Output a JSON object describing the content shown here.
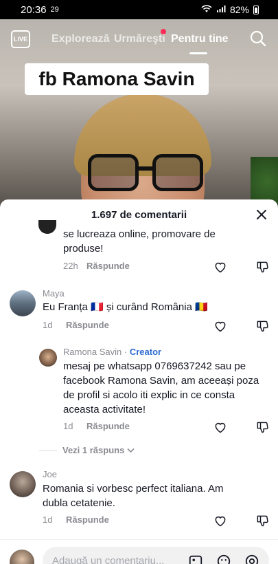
{
  "status_bar": {
    "time": "20:36",
    "notif": "29",
    "battery": "82%"
  },
  "top_nav": {
    "live_label": "LIVE",
    "tabs": [
      {
        "label": "Explorează"
      },
      {
        "label": "Urmăreşti"
      },
      {
        "label": "Pentru tine",
        "active": true
      }
    ]
  },
  "video": {
    "overlay_text": "fb Ramona Savin"
  },
  "comments": {
    "title": "1.697 de comentarii",
    "items": [
      {
        "text": "se lucreaza online, promovare de produse!",
        "time": "22h",
        "reply": "Răspunde"
      },
      {
        "user": "Maya",
        "text": "Eu Franța 🇫🇷 și curând România 🇷🇴",
        "time": "1d",
        "reply": "Răspunde"
      },
      {
        "user": "Ramona Savin",
        "creator_label": "Creator",
        "text": "mesaj pe whatsapp 0769637242 sau pe facebook Ramona Savin, am aceeași poza de profil si acolo iti explic in ce consta aceasta activitate!",
        "time": "1d",
        "reply": "Răspunde"
      },
      {
        "user": "Joe",
        "text": "Romania si vorbesc perfect italiana. Am dubla cetatenie.",
        "time": "1d",
        "reply": "Răspunde"
      }
    ],
    "view_replies": "Vezi 1 răspuns"
  },
  "input_bar": {
    "placeholder": "Adaugă un comentariu..."
  },
  "colors": {
    "accent": "#fe2c55",
    "creator": "#2f6cd1",
    "muted": "#8a8b91"
  }
}
